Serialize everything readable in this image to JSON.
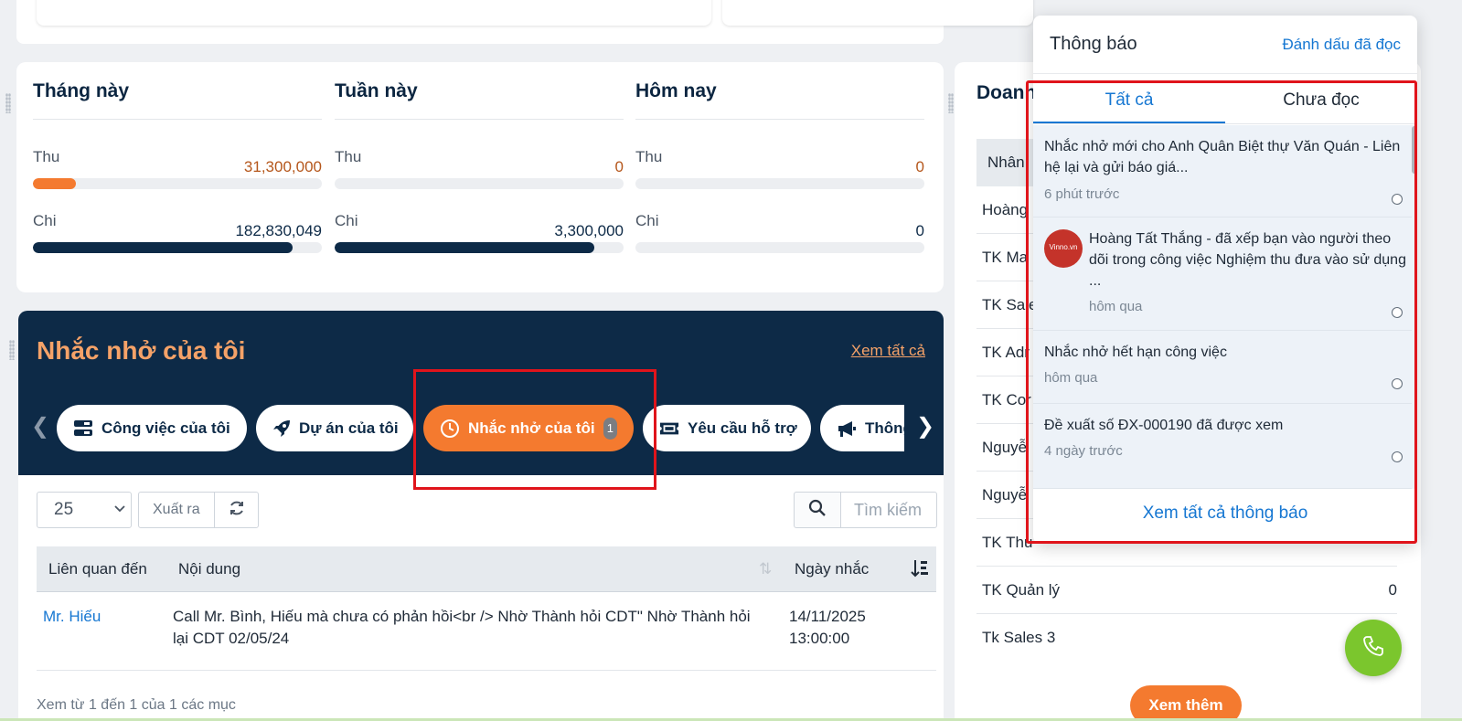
{
  "stats": [
    {
      "title": "Tháng này",
      "income_label": "Thu",
      "income_value": "31,300,000",
      "income_fill": 0.15,
      "expense_label": "Chi",
      "expense_value": "182,830,049",
      "expense_fill": 0.9
    },
    {
      "title": "Tuần này",
      "income_label": "Thu",
      "income_value": "0",
      "income_fill": 0,
      "expense_label": "Chi",
      "expense_value": "3,300,000",
      "expense_fill": 0.9
    },
    {
      "title": "Hôm nay",
      "income_label": "Thu",
      "income_value": "0",
      "income_fill": 0,
      "expense_label": "Chi",
      "expense_value": "0",
      "expense_fill": 0
    }
  ],
  "colors": {
    "income_bar": "#f47a2f",
    "expense_bar": "#0d2a47",
    "income_value": "#b5571c",
    "header_bg": "#0d2a47",
    "accent_orange": "#f47a2f",
    "link_blue": "#1677d2",
    "highlight_red": "#e0141b"
  },
  "reminders": {
    "title": "Nhắc nhở của tôi",
    "view_all": "Xem tất cả",
    "tabs": [
      {
        "label": "Công việc của tôi",
        "icon": "tasks-icon"
      },
      {
        "label": "Dự án của tôi",
        "icon": "rocket-icon"
      },
      {
        "label": "Nhắc nhở của tôi",
        "icon": "clock-icon",
        "badge": "1",
        "active": true
      },
      {
        "label": "Yêu cầu hỗ trợ",
        "icon": "ticket-icon"
      },
      {
        "label": "Thông",
        "icon": "megaphone-icon"
      }
    ],
    "page_size": "25",
    "export_label": "Xuất ra",
    "search_placeholder": "Tìm kiếm",
    "columns": [
      "Liên quan đến",
      "Nội dung",
      "Ngày nhắc"
    ],
    "rows": [
      {
        "related": "Mr. Hiếu",
        "content": "Call Mr. Bình, Hiếu mà chưa có phản hồi<br /> Nhờ Thành hỏi CDT\" Nhờ Thành hỏi lại CDT 02/05/24",
        "date": "14/11/2025",
        "time": "13:00:00"
      }
    ],
    "footer_info": "Xem từ 1 đến 1 của 1 các mục"
  },
  "side_card": {
    "title": "Doanh",
    "column": "Nhân",
    "rows": [
      {
        "name": "Hoàng",
        "value": ""
      },
      {
        "name": "TK Ma",
        "value": ""
      },
      {
        "name": "TK Sale",
        "value": ""
      },
      {
        "name": "TK Adr",
        "value": ""
      },
      {
        "name": "TK Cor",
        "value": ""
      },
      {
        "name": "Nguyễ",
        "value": ""
      },
      {
        "name": "Nguyễ",
        "value": ""
      },
      {
        "name": "TK Thu",
        "value": ""
      },
      {
        "name": "TK Quản lý",
        "value": "0"
      },
      {
        "name": "Tk Sales 3",
        "value": ""
      }
    ],
    "more_label": "Xem thêm"
  },
  "notifications": {
    "title": "Thông báo",
    "mark_read": "Đánh dấu đã đọc",
    "tab_all": "Tất cả",
    "tab_unread": "Chưa đọc",
    "items": [
      {
        "text": "Nhắc nhở mới cho Anh Quân Biệt thự Văn Quán - Liên hệ lại và gửi báo giá...",
        "time": "6 phút trước",
        "avatar": false
      },
      {
        "text": "Hoàng Tất Thắng - đã xếp bạn vào người theo dõi trong công việc Nghiệm thu đưa vào sử dụng ...",
        "time": "hôm qua",
        "avatar": true,
        "avatar_text": "Vinno.vn"
      },
      {
        "text": "Nhắc nhở hết hạn công việc",
        "time": "hôm qua",
        "avatar": false
      },
      {
        "text": "Đề xuất số ĐX-000190 đã được xem",
        "time": "4 ngày trước",
        "avatar": false
      }
    ],
    "view_all": "Xem tất cả thông báo"
  }
}
